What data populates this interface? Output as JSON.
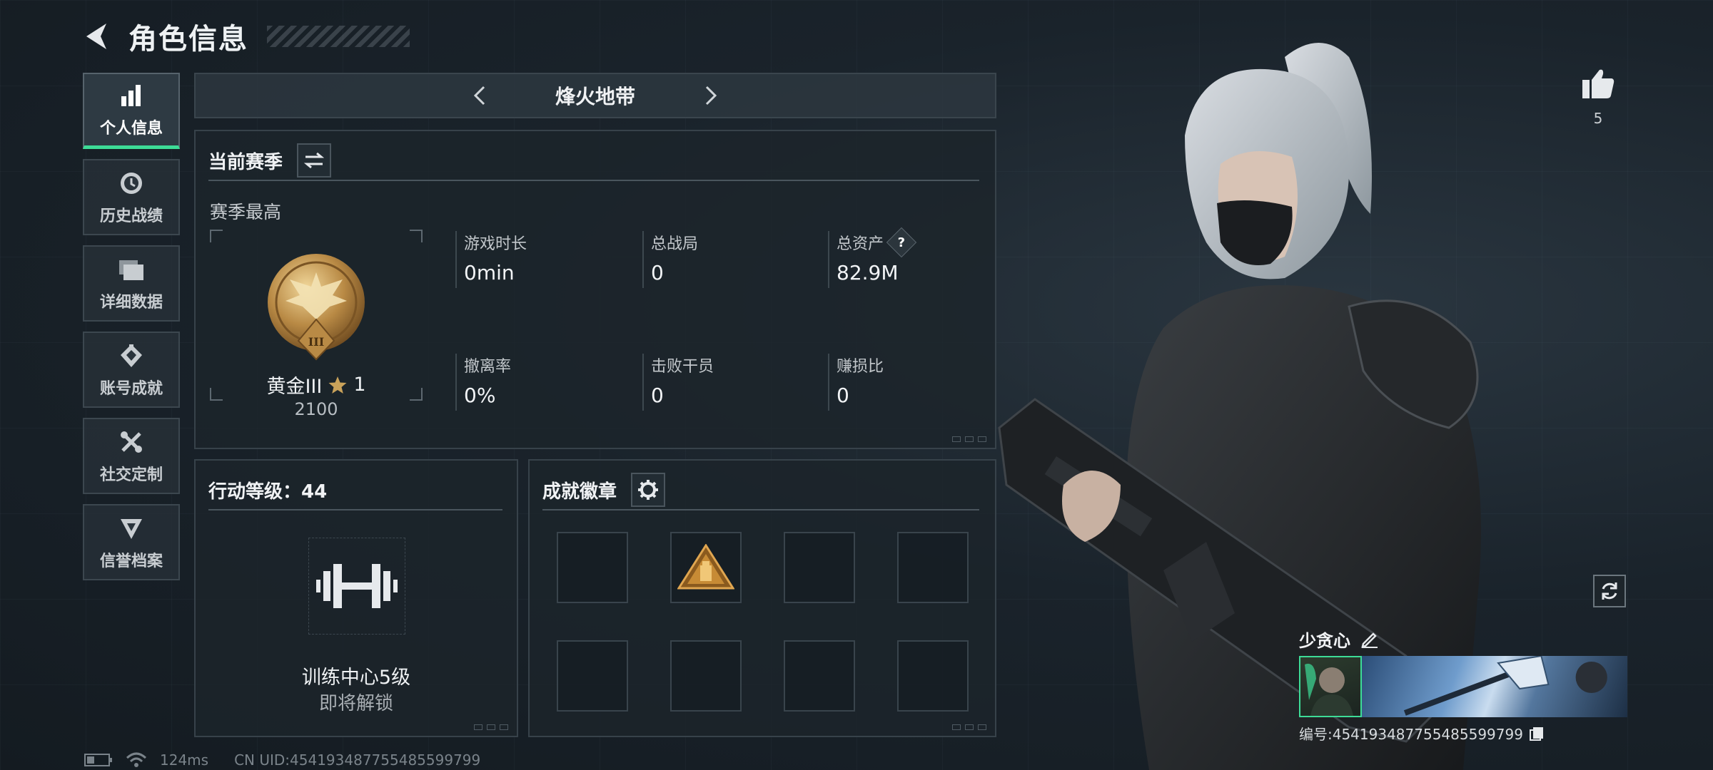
{
  "header": {
    "title": "角色信息"
  },
  "nav": {
    "items": [
      {
        "label": "个人信息",
        "icon": "bar-chart-icon",
        "active": true
      },
      {
        "label": "历史战绩",
        "icon": "history-clock-icon",
        "active": false
      },
      {
        "label": "详细数据",
        "icon": "folders-icon",
        "active": false
      },
      {
        "label": "账号成就",
        "icon": "achievement-icon",
        "active": false
      },
      {
        "label": "社交定制",
        "icon": "tools-icon",
        "active": false
      },
      {
        "label": "信誉档案",
        "icon": "reputation-icon",
        "active": false
      }
    ]
  },
  "mode": {
    "name": "烽火地带"
  },
  "season": {
    "title": "当前赛季",
    "subtitle": "赛季最高",
    "rank": {
      "name": "黄金III",
      "stars": "1",
      "score": "2100",
      "medal_numeral": "III"
    },
    "stats": [
      {
        "label": "游戏时长",
        "value": "0min"
      },
      {
        "label": "总战局",
        "value": "0"
      },
      {
        "label": "总资产",
        "value": "82.9M",
        "has_help": true,
        "help": "?"
      },
      {
        "label": "撤离率",
        "value": "0%"
      },
      {
        "label": "击败干员",
        "value": "0"
      },
      {
        "label": "赚损比",
        "value": "0"
      }
    ]
  },
  "level": {
    "title": "行动等级：44",
    "unlock_name": "训练中心5级",
    "unlock_status": "即将解锁"
  },
  "badges": {
    "title": "成就徽章",
    "slots": 8,
    "filled_index": 1
  },
  "profile": {
    "likes": "5",
    "player_name": "少贪心",
    "uid_label": "编号:454193487755485599799"
  },
  "status": {
    "ping": "124ms",
    "uid": "CN UID:454193487755485599799"
  },
  "colors": {
    "accent": "#3ddc97",
    "panel": "#1c242b",
    "gold": "#c9a25a"
  }
}
